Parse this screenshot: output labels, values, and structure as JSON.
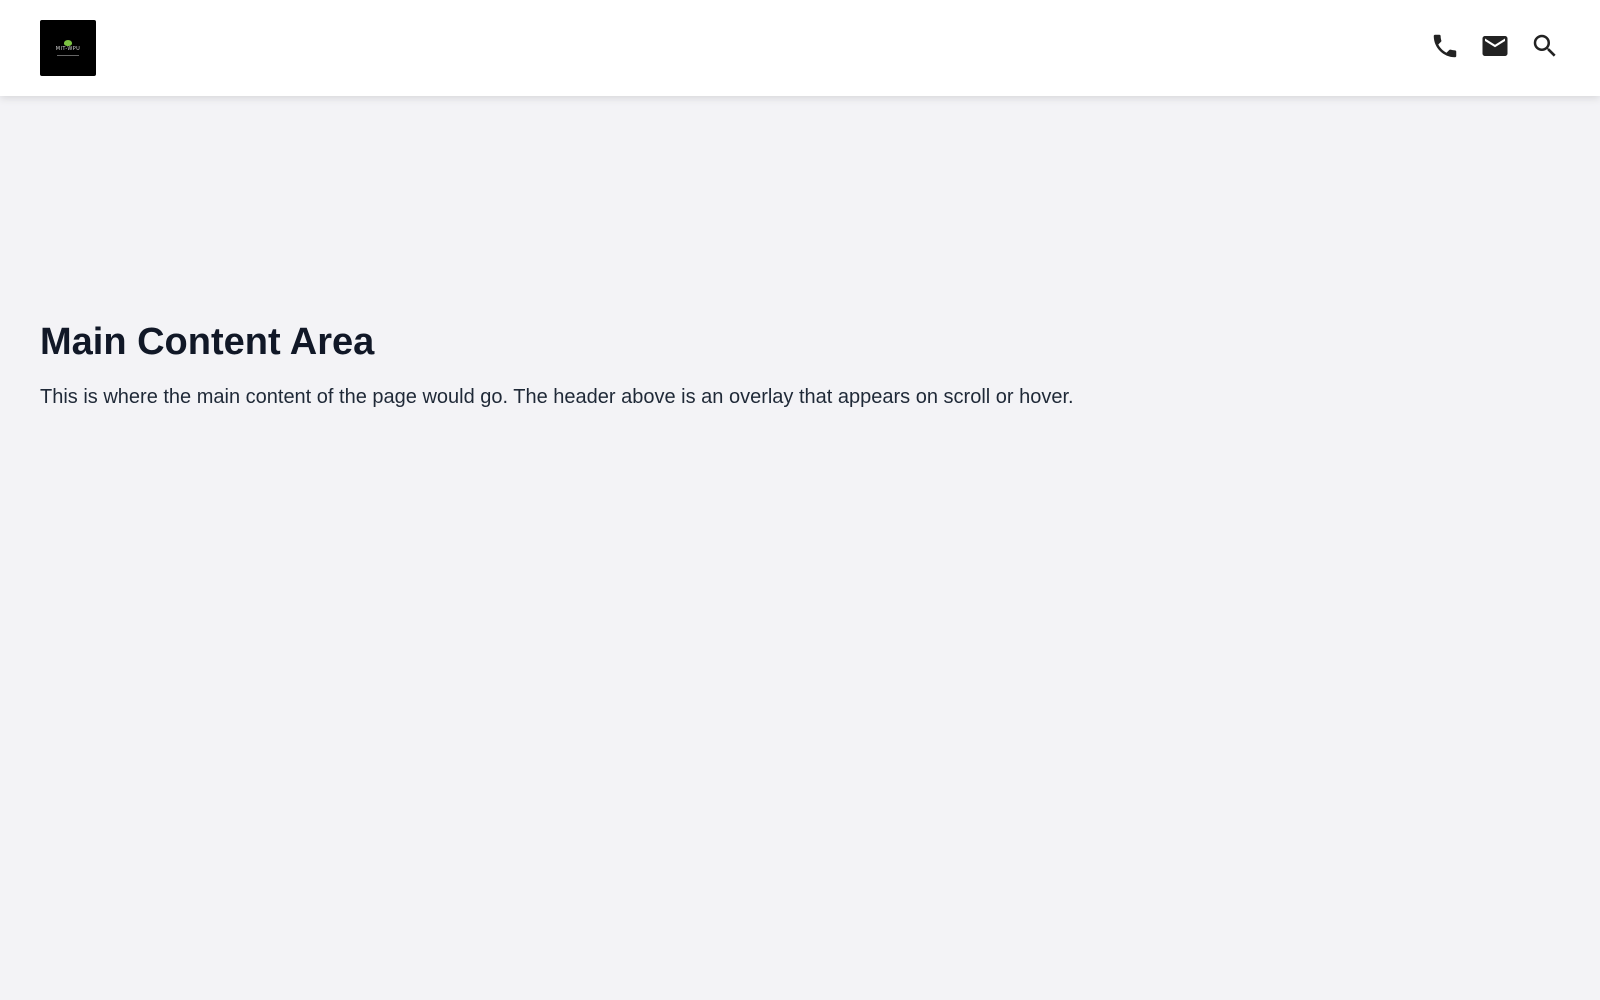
{
  "header": {
    "logo": {
      "text": "MIT-WPU",
      "icon": "logo-icon"
    },
    "actions": [
      {
        "icon": "phone-icon"
      },
      {
        "icon": "mail-icon"
      },
      {
        "icon": "search-icon"
      }
    ]
  },
  "main": {
    "title": "Main Content Area",
    "description": "This is where the main content of the page would go. The header above is an overlay that appears on scroll or hover."
  },
  "colors": {
    "background": "#f3f3f6",
    "header": "#ffffff",
    "logo_background": "#000000",
    "logo_accent": "#7cc242",
    "text": "#111827",
    "icons": "#222222"
  }
}
